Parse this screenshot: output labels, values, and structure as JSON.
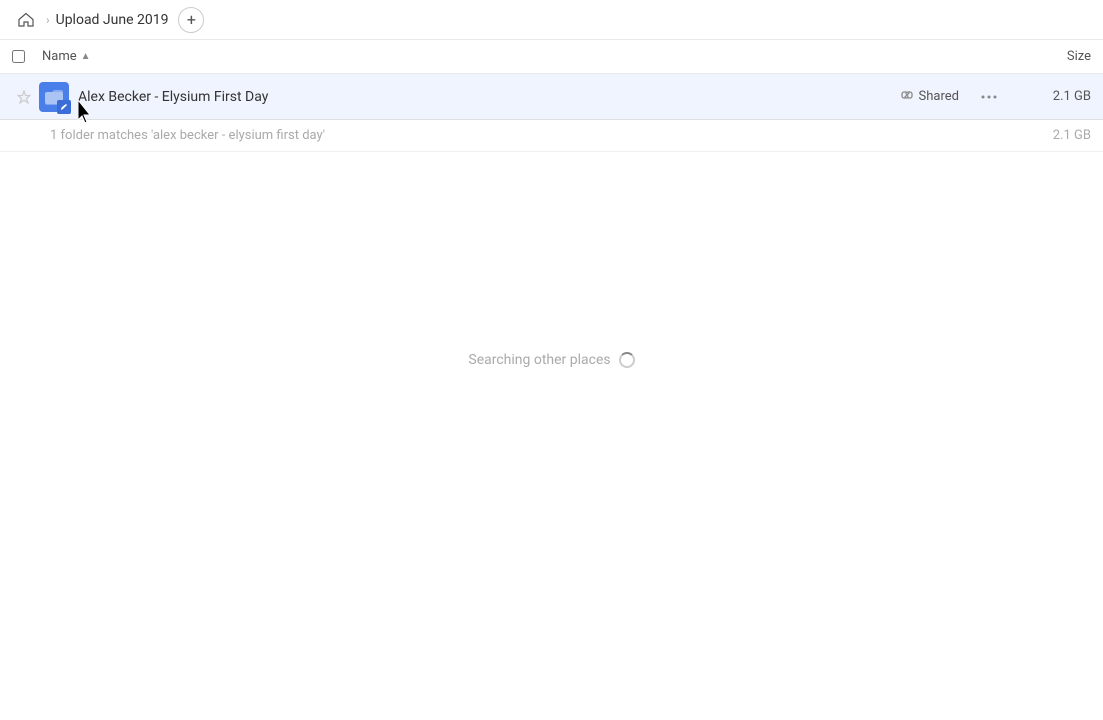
{
  "breadcrumb": {
    "home_label": "Home",
    "title": "Upload June 2019",
    "add_button_label": "+"
  },
  "columns": {
    "name_label": "Name",
    "name_sort_indicator": "▲",
    "size_label": "Size"
  },
  "file_row": {
    "name": "Alex Becker - Elysium First Day",
    "shared_label": "Shared",
    "size": "2.1 GB",
    "more_icon": "···"
  },
  "search_info": {
    "text": "1 folder matches 'alex becker - elysium first day'",
    "size": "2.1 GB"
  },
  "searching": {
    "label": "Searching other places"
  },
  "icons": {
    "home": "⌂",
    "chevron_right": "›",
    "star_empty": "☆",
    "folder": "📁",
    "link": "🔗",
    "more": "⋯"
  }
}
